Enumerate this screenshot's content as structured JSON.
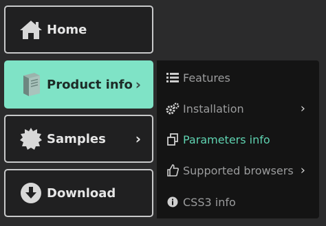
{
  "main_menu": [
    {
      "label": "Home",
      "icon": "home-icon"
    },
    {
      "label": "Product info",
      "icon": "book-icon"
    },
    {
      "label": "Samples",
      "icon": "badge-icon"
    },
    {
      "label": "Download",
      "icon": "download-icon"
    }
  ],
  "submenu": [
    {
      "label": "Features",
      "icon": "list-icon"
    },
    {
      "label": "Installation",
      "icon": "gears-icon"
    },
    {
      "label": "Parameters info",
      "icon": "copy-icon"
    },
    {
      "label": "Supported browsers",
      "icon": "thumbs-up-icon"
    },
    {
      "label": "CSS3 info",
      "icon": "info-icon"
    }
  ],
  "colors": {
    "accent": "#7fe3c6",
    "accent_text": "#5fd3b1",
    "background": "#2b2b2c",
    "item_bg": "#202021",
    "submenu_bg": "#141414"
  }
}
